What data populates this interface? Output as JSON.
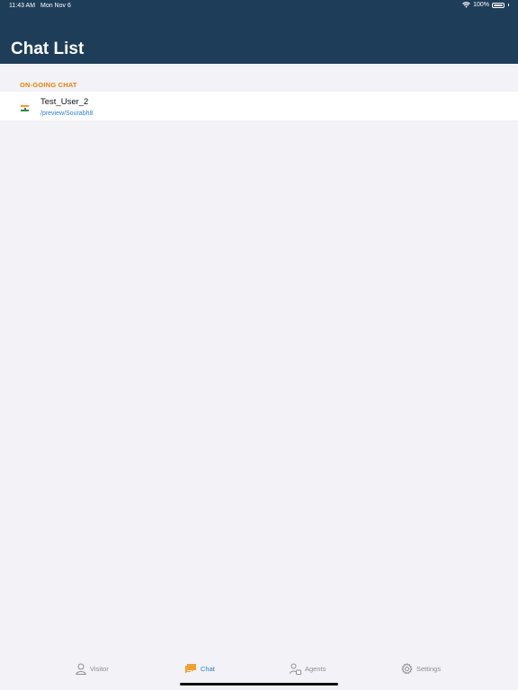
{
  "status_bar": {
    "time": "11:43 AM",
    "date": "Mon Nov 6",
    "battery": "100%"
  },
  "header": {
    "title": "Chat List",
    "background": "#1e3d59"
  },
  "section": {
    "label": "ON-GOING CHAT",
    "color": "#e8820c"
  },
  "chats": [
    {
      "name": "Test_User_2",
      "path": "/preview/Sourabh8",
      "flag": "india-flag-icon"
    }
  ],
  "tabs": [
    {
      "label": "Visitor",
      "icon": "person-icon",
      "active": false
    },
    {
      "label": "Chat",
      "icon": "chat-bubbles-icon",
      "active": true
    },
    {
      "label": "Agents",
      "icon": "agents-icon",
      "active": false
    },
    {
      "label": "Settings",
      "icon": "gear-icon",
      "active": false
    }
  ],
  "colors": {
    "accent": "#2a7fd4",
    "chat_icon": "#f0a030",
    "inactive": "#8e8e93"
  }
}
